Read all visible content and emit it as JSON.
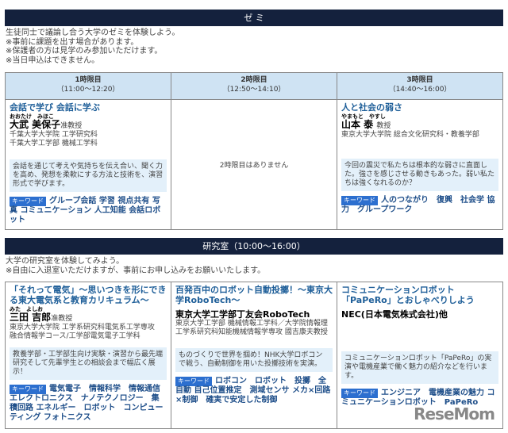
{
  "zemi": {
    "header": "ゼ ミ",
    "intro": [
      "生徒同士で議論し合う大学のゼミを体験しよう。",
      "※事前に課題を出す場合があります。",
      "※保護者の方は見学のみ参加いただけます。",
      "※当日申込はできません。"
    ],
    "periods": [
      {
        "label": "1時限目",
        "time": "（11:00〜12:20）"
      },
      {
        "label": "2時限目",
        "time": "（12:50〜14:10）"
      },
      {
        "label": "3時限目",
        "time": "（14:40〜16:00）"
      }
    ],
    "keyword_label": "キーワード",
    "session1": {
      "title": "会話で学び 会話に学ぶ",
      "ruby": "おおたけ　みほこ",
      "name": "大武 美保子",
      "rank": "准教授",
      "affiliation": [
        "千葉大学大学院 工学研究科",
        "千葉大学工学部 機械工学科"
      ],
      "description": "会話を通じて考えや気持ちを伝え合い、聞く力を高め、発想を柔軟にする方法と技術を、演習形式で学びます。",
      "keywords": "グループ会話 学習 視点共有 写真 コミュニケーション 人工知能 会話ロボット"
    },
    "session2": {
      "empty": "2時限目はありません"
    },
    "session3": {
      "title": "人と社会の弱さ",
      "ruby": "やまもと　やすし",
      "name": "山本 泰",
      "rank": "教授",
      "affiliation": [
        "東京大学大学院 総合文化研究科・教養学部"
      ],
      "description": "今回の震災で私たちは根本的な弱さに直面した。強さを感じさせる動きもあった。弱い私たちは強くなれるのか？",
      "keywords": "人のつながり　復興　社会学 協力　グループワーク"
    }
  },
  "lab": {
    "header": "研究室（10:00〜16:00）",
    "intro": [
      "大学の研究室を体験してみよう。",
      "※自由に入退室いただけますが、事前にお申し込みをお願いいたします。"
    ],
    "items": [
      {
        "title": "「それって電気」〜思いつきを形にできる東大電気系と教育カリキュラム〜",
        "ruby": "みた　よしお",
        "name": "三田 吉郎",
        "rank": "准教授",
        "affiliation": [
          "東京大学大学院 工学系研究科電気系工学専攻",
          "融合情報学コース/工学部電気電子工学科"
        ],
        "description": "教養学部・工学部生向け実験・演習から最先端研究そして先輩学生との相談会まで幅広く展示！",
        "keywords": "電気電子　情報科学　情報通信 エレクトロニクス　ナノテクノロジー　集積回路 エネルギー　ロボット　コンピューティング フォトニクス"
      },
      {
        "title": "百発百中のロボット自動投擲！〜東京大学RoboTech〜",
        "name": "東京大学工学部丁友会RoboTech",
        "affiliation": [
          "東京大学工学部 機械情報工学科／大学院情報理工学系研究科知能機械情報学専攻 國吉康夫教授"
        ],
        "description": "ものづくりで世界を掴め！NHK大学ロボコンで戦う、自動制御を用いた投擲技術を実演。",
        "keywords": "ロボコン　ロボット　投擲　全自動 自己位置推定　測域センサ メカ×回路×制御　確実で安定した制御"
      },
      {
        "title": "コミュニケーションロボット「PaPeRo」とおしゃべりしよう",
        "name": "NEC(日本電気株式会社)他",
        "affiliation": [],
        "description": "コミュニケーションロボット「PaPeRo」の実演や電機産業で働く魅力の紹介などを行います。",
        "keywords": "エンジニア　電機産業の魅力 コミュニケーションロボット　PaPeRo"
      }
    ]
  },
  "logo": "ReseMom"
}
